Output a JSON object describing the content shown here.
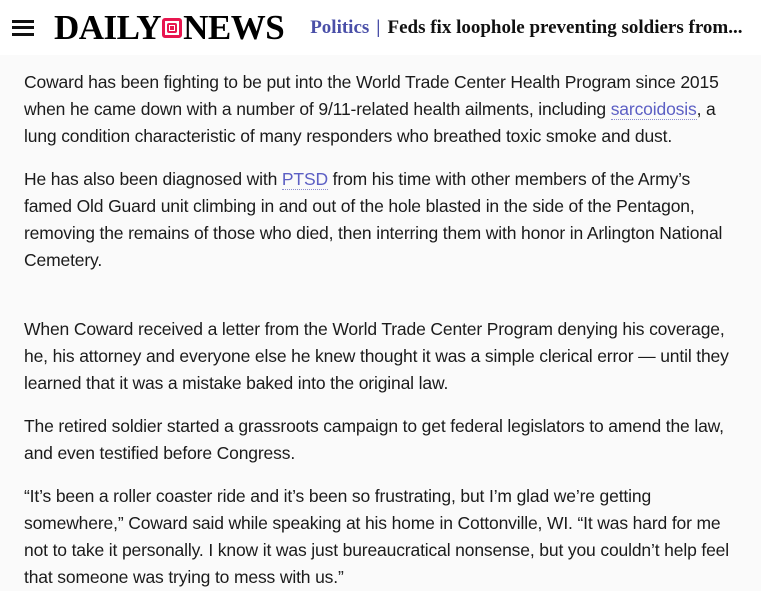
{
  "header": {
    "menu_icon": "hamburger-menu-icon",
    "logo": {
      "word_left": "DAILY",
      "mark_icon": "camera-square-icon",
      "word_right": "NEWS",
      "mark_color": "#e8164f"
    },
    "teaser": {
      "kicker": "Politics",
      "separator": "|",
      "title": "Feds fix loophole preventing soldiers from...",
      "kicker_color": "#4a4fa8"
    }
  },
  "article": {
    "paragraphs": [
      {
        "id": "p1",
        "parts": [
          {
            "type": "text",
            "value": "Coward has been fighting to be put into the World Trade Center Health Program since 2015 when he came down with a number of 9/11-related health ailments, including "
          },
          {
            "type": "link",
            "value": "sarcoidosis"
          },
          {
            "type": "text",
            "value": ", a lung condition characteristic of many responders who breathed toxic smoke and dust."
          }
        ]
      },
      {
        "id": "p2",
        "parts": [
          {
            "type": "text",
            "value": "He has also been diagnosed with "
          },
          {
            "type": "link",
            "value": "PTSD"
          },
          {
            "type": "text",
            "value": " from his time with other members of the Army’s famed Old Guard unit climbing in and out of the hole blasted in the side of the Pentagon, removing the remains of those who died, then interring them with honor in Arlington National Cemetery."
          }
        ]
      },
      {
        "id": "p3",
        "parts": [
          {
            "type": "text",
            "value": "When Coward received a letter from the World Trade Center Program denying his coverage, he, his attorney and everyone else he knew thought it was a simple clerical error — until they learned that it was a mistake baked into the original law."
          }
        ]
      },
      {
        "id": "p4",
        "parts": [
          {
            "type": "text",
            "value": "The retired soldier started a grassroots campaign to get federal legislators to amend the law, and even testified before Congress."
          }
        ]
      },
      {
        "id": "p5",
        "parts": [
          {
            "type": "text",
            "value": "“It’s been a roller coaster ride and it’s been so frustrating, but I’m glad we’re getting somewhere,” Coward said while speaking at his home in Cottonville, WI. “It was hard for me not to take it personally. I know it was just bureaucratical nonsense, but you couldn’t help feel that someone was trying to mess with us.”"
          }
        ]
      }
    ],
    "link_color": "#5c5fc4",
    "text_color": "#1b1b1b"
  },
  "page": {
    "background": "#fafafa",
    "header_background": "#ffffff"
  }
}
